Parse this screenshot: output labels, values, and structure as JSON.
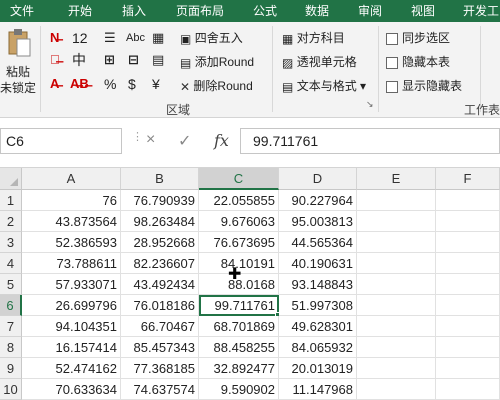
{
  "tabs": [
    "文件",
    "开始",
    "插入",
    "页面布局",
    "公式",
    "数据",
    "审阅",
    "视图",
    "开发工"
  ],
  "ribbon": {
    "paste_label": "粘贴",
    "unlock_label": "未锁定",
    "font_row1": [
      "12"
    ],
    "font_row2": [
      "中"
    ],
    "small_symbols": [
      "Abc",
      "%",
      "$",
      "¥"
    ],
    "middle_items": [
      "四舍五入",
      "添加Round",
      "删除Round"
    ],
    "right_items": [
      "对方科目",
      "透视单元格",
      "文本与格式"
    ],
    "checks": [
      "同步选区",
      "隐藏本表",
      "显示隐藏表"
    ],
    "group_label_region": "区域",
    "group_label_worksheet": "工作表"
  },
  "formula_bar": {
    "name_box": "C6",
    "cancel_icon": "×",
    "enter_icon": "✓",
    "fx_label": "fx",
    "formula_value": "99.711761"
  },
  "grid": {
    "columns": [
      "A",
      "B",
      "C",
      "D",
      "E",
      "F"
    ],
    "active_column": "C",
    "active_row": "6",
    "rows": [
      {
        "label": "1",
        "cells": [
          "76",
          "76.790939",
          "22.055855",
          "90.227964",
          "",
          ""
        ]
      },
      {
        "label": "2",
        "cells": [
          "43.873564",
          "98.263484",
          "9.676063",
          "95.003813",
          "",
          ""
        ]
      },
      {
        "label": "3",
        "cells": [
          "52.386593",
          "28.952668",
          "76.673695",
          "44.565364",
          "",
          ""
        ]
      },
      {
        "label": "4",
        "cells": [
          "73.788611",
          "82.236607",
          "84.10191",
          "40.190631",
          "",
          ""
        ]
      },
      {
        "label": "5",
        "cells": [
          "57.933071",
          "43.492434",
          "88.0168",
          "93.148843",
          "",
          ""
        ]
      },
      {
        "label": "6",
        "cells": [
          "26.699796",
          "76.018186",
          "99.711761",
          "51.997308",
          "",
          ""
        ]
      },
      {
        "label": "7",
        "cells": [
          "94.104351",
          "66.70467",
          "68.701869",
          "49.628301",
          "",
          ""
        ]
      },
      {
        "label": "8",
        "cells": [
          "16.157414",
          "85.457343",
          "88.458255",
          "84.065932",
          "",
          ""
        ]
      },
      {
        "label": "9",
        "cells": [
          "52.474162",
          "77.368185",
          "32.892477",
          "20.013019",
          "",
          ""
        ]
      },
      {
        "label": "10",
        "cells": [
          "70.633634",
          "74.637574",
          "9.590902",
          "11.147968",
          "",
          ""
        ]
      }
    ]
  },
  "colors": {
    "accent": "#217346"
  }
}
